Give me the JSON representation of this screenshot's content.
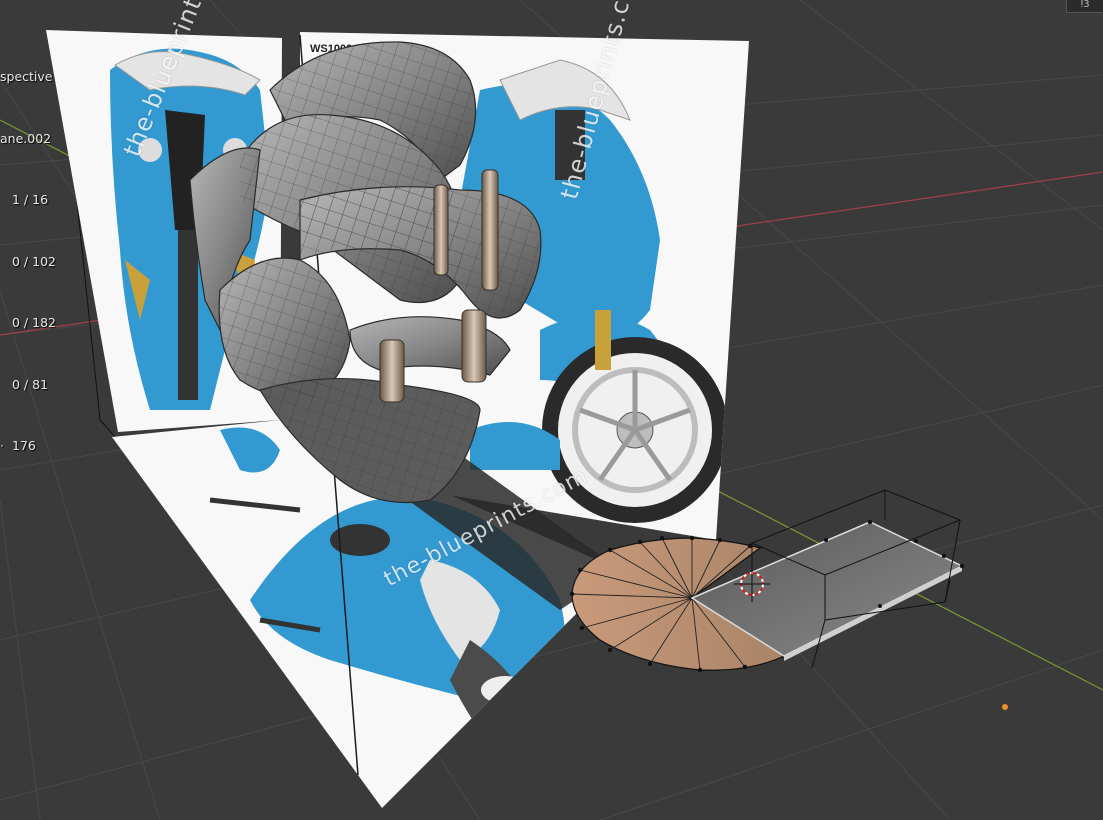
{
  "viewport": {
    "view_name": "spective",
    "object_name": "ane.002",
    "stats": [
      {
        "label": "",
        "value": "1 / 16"
      },
      {
        "label": "",
        "value": "0 / 102"
      },
      {
        "label": "",
        "value": "0 / 182"
      },
      {
        "label": "",
        "value": "0 / 81"
      },
      {
        "label": "·",
        "value": "176"
      }
    ],
    "corner_label": "ⵑ3",
    "model_tag": "WS1000 RR",
    "watermark_text": "the-blueprints.com"
  },
  "colors": {
    "background": "#3a3a3a",
    "grid": "#484848",
    "x_axis": "#a0404a",
    "y_axis": "#7a9a34",
    "bike_blue": "#3399d1",
    "fork_gold": "#c9a13a",
    "mesh_gray": "#8c8c8c",
    "selected_face": "#c49a78",
    "cursor_red": "#d02020",
    "origin_orange": "#f0902a"
  },
  "icons": {
    "cursor": "3d-cursor-icon",
    "origin": "object-origin-icon"
  }
}
